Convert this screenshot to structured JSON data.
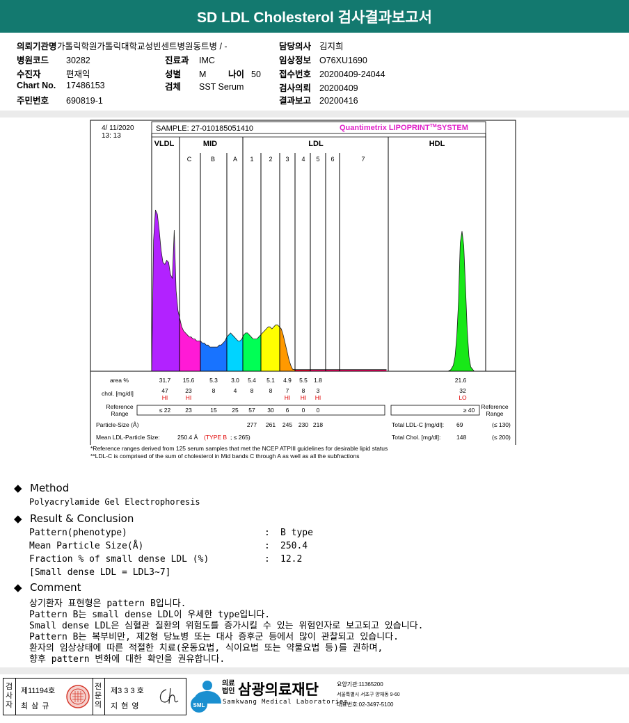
{
  "title": "SD LDL Cholesterol 검사결과보고서",
  "info": {
    "hospital_label": "의뢰기관명",
    "hospital": "가톨릭학원가톨릭대학교성빈센트병원",
    "ward": "동트병 / -",
    "doctor_label": "담당의사",
    "doctor": "김지희",
    "code_label": "병원코드",
    "code": "30282",
    "dept_label": "진료과",
    "dept": "IMC",
    "clinical_label": "임상정보",
    "clinical": "O76XU1690",
    "patient_label": "수진자",
    "patient": "편재익",
    "sex_label": "성별",
    "sex": "M",
    "age_label": "나이",
    "age": "50",
    "receipt_label": "접수번호",
    "receipt": "20200409-24044",
    "chart_label": "Chart No.",
    "chart": "17486153",
    "specimen_label": "검체",
    "specimen": "SST Serum",
    "request_label": "검사의뢰",
    "request": "20200409",
    "id_label": "주민번호",
    "id": "690819-1",
    "report_label": "결과보고",
    "report": "20200416"
  },
  "chart_data": {
    "type": "area",
    "date": "4/ 11/2020",
    "time": "13: 13",
    "sample": "SAMPLE:  27-010185051410",
    "system": "Quantimetrix LIPOPRINT",
    "system_tm": "TM",
    "system_suffix": "SYSTEM",
    "group_labels": [
      "VLDL",
      "MID",
      "LDL",
      "HDL"
    ],
    "band_labels": [
      "C",
      "B",
      "A",
      "1",
      "2",
      "3",
      "4",
      "5",
      "6",
      "7"
    ],
    "band_colors": [
      "#b222ff",
      "#ff1ad6",
      "#1873ff",
      "#00d4ff",
      "#00ff55",
      "#ffff00",
      "#ff9900",
      "#ff0033",
      "#ff0066",
      "#18e818"
    ],
    "curve": {
      "x": [
        0,
        2,
        4,
        6,
        8,
        10,
        12,
        14,
        16,
        18,
        20,
        22,
        24,
        26,
        28,
        30,
        32,
        34,
        36,
        38,
        40,
        42,
        44,
        46,
        48,
        50,
        52,
        54,
        56,
        58,
        60,
        62,
        64,
        66,
        68,
        70,
        72,
        74,
        76,
        78,
        80,
        82,
        84,
        86,
        88,
        90,
        92,
        94,
        96,
        98,
        100,
        102,
        104,
        106,
        108,
        110,
        112,
        114,
        116,
        118,
        120,
        122,
        124,
        126,
        128,
        130,
        132,
        134,
        136,
        138,
        140,
        142,
        144,
        146,
        148,
        150,
        152,
        154,
        156,
        158,
        160,
        162,
        164,
        166,
        168,
        170,
        172,
        174,
        176,
        178,
        180,
        182,
        184,
        186,
        188,
        190,
        192,
        194,
        196,
        198,
        200,
        202,
        204,
        206,
        208,
        210,
        212,
        214,
        216,
        218,
        220,
        222,
        224,
        226,
        228,
        230,
        232,
        234,
        236,
        238,
        240,
        242,
        244,
        246,
        248,
        250
      ],
      "y": [
        0,
        65,
        80,
        78,
        70,
        60,
        54,
        53,
        55,
        54,
        48,
        46,
        70,
        40,
        30,
        26,
        22,
        20,
        19,
        18,
        17,
        17,
        16,
        16,
        15,
        15,
        15,
        14,
        14,
        13,
        13,
        12,
        12,
        12,
        12,
        12,
        13,
        13,
        14,
        15,
        17,
        18,
        19,
        18,
        17,
        16,
        15,
        15,
        16,
        18,
        19,
        19,
        18,
        17,
        16,
        16,
        16,
        17,
        18,
        19,
        20,
        21,
        22,
        22,
        21,
        22,
        23,
        23,
        22,
        21,
        18,
        14,
        10,
        6,
        3,
        1,
        0.8,
        0.8,
        0.8,
        0.8,
        0.8,
        0.8,
        0.8,
        0.8,
        0.8,
        0.8,
        0.8,
        0.8,
        0.8,
        0.8,
        0.8,
        0.8,
        0.8,
        0.8,
        0.8,
        0.8,
        0.8,
        0.8,
        0.8,
        0.8,
        0.8,
        0.8,
        0.8,
        0.8,
        0.8,
        0.8,
        0.8,
        0.8,
        0.8,
        0.8,
        0.8,
        0.8,
        0.8,
        0.8,
        0.8,
        0.8,
        0.8,
        0.8,
        0.8,
        0.8,
        0.8,
        0.8,
        0.8,
        0.8,
        0.8,
        0.8
      ]
    },
    "hdl_peak": {
      "x": [
        0,
        3,
        6,
        8,
        10,
        12,
        13,
        14,
        16,
        18,
        20,
        22,
        24,
        26,
        30
      ],
      "y": [
        0,
        1,
        4,
        10,
        24,
        48,
        70,
        88,
        96,
        86,
        58,
        28,
        10,
        3,
        0
      ]
    },
    "table": {
      "row_labels": [
        "area %",
        "chol. [mg/dl]",
        "Reference Range",
        "Particle-Size (Å)",
        "Mean LDL-Particle Size:"
      ],
      "area": [
        "31.7",
        "15.6",
        "5.3",
        "3.0",
        "5.4",
        "5.1",
        "4.9",
        "5.5",
        "1.8",
        "",
        "21.6"
      ],
      "chol": [
        "47",
        "23",
        "8",
        "4",
        "8",
        "8",
        "7",
        "8",
        "3",
        "",
        "32"
      ],
      "flags": [
        "HI",
        "HI",
        "",
        "",
        "",
        "",
        "HI",
        "HI",
        "HI",
        "",
        "LO"
      ],
      "ref": [
        "≤ 22",
        "23",
        "15",
        "25",
        "57",
        "30",
        "6",
        "0",
        "0",
        "",
        "≥ 40"
      ],
      "particle": [
        "",
        "",
        "",
        "",
        "277",
        "261",
        "245",
        "230",
        "218"
      ],
      "mean_size": "250.4 Å",
      "mean_type": "(TYPE B",
      "mean_ref": "; ≤ 265)",
      "total_ldl_label": "Total LDL-C [mg/dl]:",
      "total_ldl": "69",
      "total_ldl_ref": "(≤ 130)",
      "total_chol_label": "Total Chol. [mg/dl]:",
      "total_chol": "148",
      "total_chol_ref": "(≤ 200)",
      "ref_right": "Reference Range"
    }
  },
  "notes": [
    "*Reference ranges derived from 125 serum samples that met the NCEP ATPIII guidelines for desirable lipid status",
    "**LDL-C is comprised of the sum of cholesterol in Mid bands C through A as well as all the subfractions"
  ],
  "method": {
    "head": "Method",
    "text": "Polyacrylamide Gel Electrophoresis"
  },
  "result": {
    "head": "Result & Conclusion",
    "rows": [
      {
        "label": "Pattern(phenotype)",
        "sep": ":",
        "value": "B type"
      },
      {
        "label": "Mean Particle Size(Å)",
        "sep": ":",
        "value": "250.4"
      },
      {
        "label": "Fraction % of small dense LDL (%)",
        "sep": ":",
        "value": "12.2"
      }
    ],
    "note": "[Small dense LDL = LDL3~7]"
  },
  "comment": {
    "head": "Comment",
    "lines": [
      "상기환자 표현형은 pattern B입니다.",
      "Pattern B는 small dense LDL이 우세한 type입니다.",
      "Small dense LDL은 심혈관 질환의 위험도를 증가시킬 수 있는 위험인자로 보고되고 있습니다.",
      "Pattern B는 복부비만, 제2형 당뇨병 또는 대사 증후군 등에서 많이 관찰되고 있습니다.",
      "환자의 임상상태에 따른 적절한 치료(운동요법, 식이요법 또는 약물요법 등)를 권하며,",
      "향후 pattern 변화에 대한 확인을 권유합니다."
    ]
  },
  "signature": {
    "col1_head": "검사자",
    "col1_no": "제11194호",
    "col1_name": "최 삼 규",
    "col2_head": "전문의",
    "col2_no": "제3 3 3 호",
    "col2_name": "지 현 영"
  },
  "footer": {
    "logo_small": "SML",
    "prefix": "의료법인",
    "name": "삼광의료재단",
    "name_en": "Samkwang Medical Laboratories",
    "line1": "요양기관:11365200",
    "line2": "서울특별시 서초구 양재동 9-60",
    "line3": "대표번호:02-3497-5100"
  }
}
